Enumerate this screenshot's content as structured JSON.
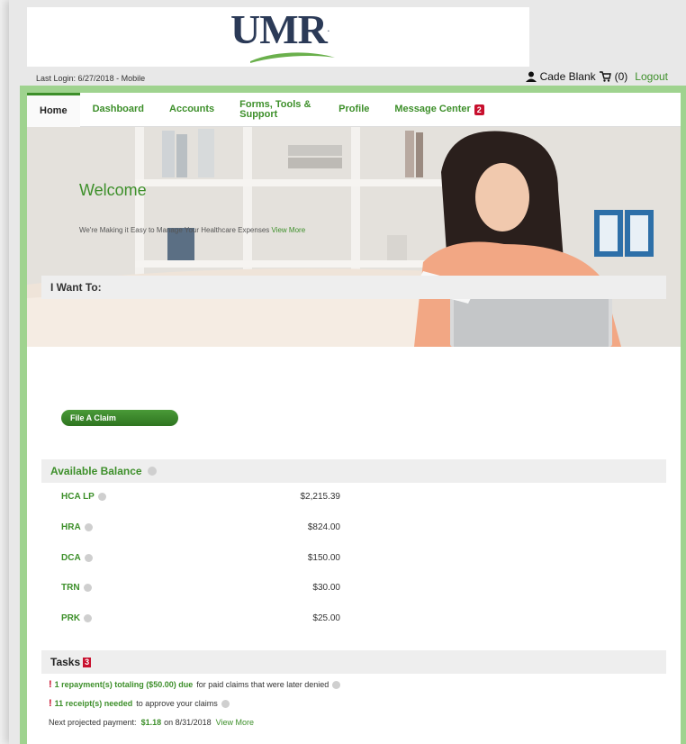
{
  "logo": {
    "text": "UMR",
    "tm": "."
  },
  "header": {
    "last_login": "Last Login: 6/27/2018 - Mobile",
    "user_name": "Cade Blank",
    "cart": "(0)",
    "logout": "Logout"
  },
  "nav": {
    "items": [
      {
        "label": "Home"
      },
      {
        "label": "Dashboard"
      },
      {
        "label": "Accounts"
      },
      {
        "label": "Forms, Tools & Support"
      },
      {
        "label": "Profile"
      },
      {
        "label": "Message Center"
      }
    ],
    "message_count": "2"
  },
  "hero": {
    "welcome": "Welcome",
    "tagline": "We're Making it Easy to Manage Your Healthcare Expenses",
    "view_more": "View More"
  },
  "i_want_to": {
    "title": "I Want To:",
    "button": "File A Claim"
  },
  "balance": {
    "title": "Available Balance",
    "rows": [
      {
        "name": "HCA LP",
        "amount": "$2,215.39"
      },
      {
        "name": "HRA",
        "amount": "$824.00"
      },
      {
        "name": "DCA",
        "amount": "$150.00"
      },
      {
        "name": "TRN",
        "amount": "$30.00"
      },
      {
        "name": "PRK",
        "amount": "$25.00"
      }
    ]
  },
  "tasks": {
    "title": "Tasks",
    "count": "3",
    "line1_bold": "1 repayment(s) totaling ($50.00) due",
    "line1_rest": "for paid claims that were later denied",
    "line2_bold": "11 receipt(s) needed",
    "line2_rest": "to approve your claims",
    "next_label": "Next projected payment:",
    "next_amount": "$1.18",
    "next_date": "on 8/31/2018",
    "view_more": "View More"
  },
  "colors": {
    "brand_green": "#3d8f2a",
    "alert_red": "#c8102e",
    "navy": "#2b3a57"
  }
}
